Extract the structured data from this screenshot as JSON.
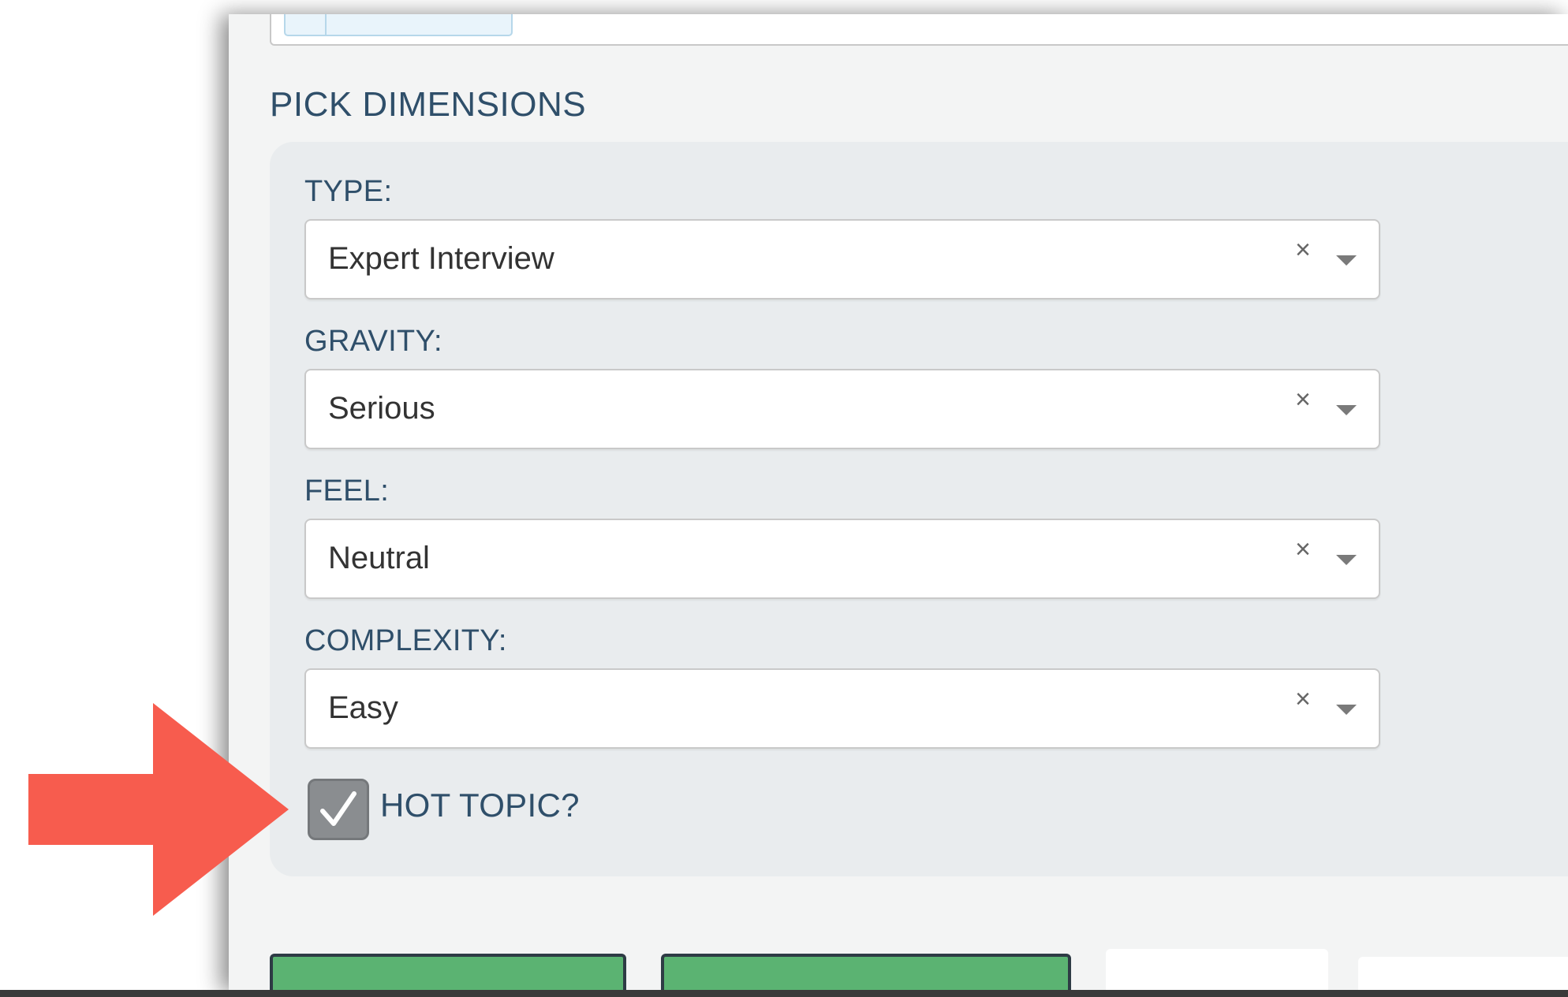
{
  "section": {
    "title": "PICK DIMENSIONS"
  },
  "dimensions": {
    "type": {
      "label": "TYPE:",
      "value": "Expert Interview",
      "clear": "×"
    },
    "gravity": {
      "label": "GRAVITY:",
      "value": "Serious",
      "clear": "×"
    },
    "feel": {
      "label": "FEEL:",
      "value": "Neutral",
      "clear": "×"
    },
    "complexity": {
      "label": "COMPLEXITY:",
      "value": "Easy",
      "clear": "×"
    }
  },
  "hot_topic": {
    "label": "HOT TOPIC?",
    "checked": true
  },
  "colors": {
    "heading": "#2f4f6a",
    "panel": "#f3f4f4",
    "dims_box": "#e9ecee",
    "checkbox": "#8a8d90",
    "green_button": "#5bb372",
    "annotation_arrow": "#f75c4e"
  },
  "icons": {
    "clear": "close-icon",
    "caret": "caret-down-icon",
    "check": "checkmark-icon",
    "annotation": "arrow-right-icon"
  }
}
